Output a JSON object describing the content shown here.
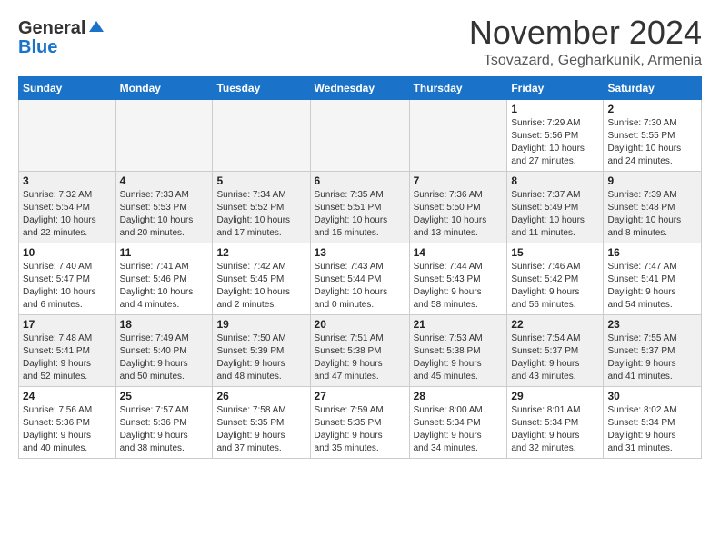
{
  "header": {
    "logo_general": "General",
    "logo_blue": "Blue",
    "month_title": "November 2024",
    "location": "Tsovazard, Gegharkunik, Armenia"
  },
  "calendar": {
    "weekdays": [
      "Sunday",
      "Monday",
      "Tuesday",
      "Wednesday",
      "Thursday",
      "Friday",
      "Saturday"
    ],
    "weeks": [
      [
        {
          "day": "",
          "info": ""
        },
        {
          "day": "",
          "info": ""
        },
        {
          "day": "",
          "info": ""
        },
        {
          "day": "",
          "info": ""
        },
        {
          "day": "",
          "info": ""
        },
        {
          "day": "1",
          "info": "Sunrise: 7:29 AM\nSunset: 5:56 PM\nDaylight: 10 hours\nand 27 minutes."
        },
        {
          "day": "2",
          "info": "Sunrise: 7:30 AM\nSunset: 5:55 PM\nDaylight: 10 hours\nand 24 minutes."
        }
      ],
      [
        {
          "day": "3",
          "info": "Sunrise: 7:32 AM\nSunset: 5:54 PM\nDaylight: 10 hours\nand 22 minutes."
        },
        {
          "day": "4",
          "info": "Sunrise: 7:33 AM\nSunset: 5:53 PM\nDaylight: 10 hours\nand 20 minutes."
        },
        {
          "day": "5",
          "info": "Sunrise: 7:34 AM\nSunset: 5:52 PM\nDaylight: 10 hours\nand 17 minutes."
        },
        {
          "day": "6",
          "info": "Sunrise: 7:35 AM\nSunset: 5:51 PM\nDaylight: 10 hours\nand 15 minutes."
        },
        {
          "day": "7",
          "info": "Sunrise: 7:36 AM\nSunset: 5:50 PM\nDaylight: 10 hours\nand 13 minutes."
        },
        {
          "day": "8",
          "info": "Sunrise: 7:37 AM\nSunset: 5:49 PM\nDaylight: 10 hours\nand 11 minutes."
        },
        {
          "day": "9",
          "info": "Sunrise: 7:39 AM\nSunset: 5:48 PM\nDaylight: 10 hours\nand 8 minutes."
        }
      ],
      [
        {
          "day": "10",
          "info": "Sunrise: 7:40 AM\nSunset: 5:47 PM\nDaylight: 10 hours\nand 6 minutes."
        },
        {
          "day": "11",
          "info": "Sunrise: 7:41 AM\nSunset: 5:46 PM\nDaylight: 10 hours\nand 4 minutes."
        },
        {
          "day": "12",
          "info": "Sunrise: 7:42 AM\nSunset: 5:45 PM\nDaylight: 10 hours\nand 2 minutes."
        },
        {
          "day": "13",
          "info": "Sunrise: 7:43 AM\nSunset: 5:44 PM\nDaylight: 10 hours\nand 0 minutes."
        },
        {
          "day": "14",
          "info": "Sunrise: 7:44 AM\nSunset: 5:43 PM\nDaylight: 9 hours\nand 58 minutes."
        },
        {
          "day": "15",
          "info": "Sunrise: 7:46 AM\nSunset: 5:42 PM\nDaylight: 9 hours\nand 56 minutes."
        },
        {
          "day": "16",
          "info": "Sunrise: 7:47 AM\nSunset: 5:41 PM\nDaylight: 9 hours\nand 54 minutes."
        }
      ],
      [
        {
          "day": "17",
          "info": "Sunrise: 7:48 AM\nSunset: 5:41 PM\nDaylight: 9 hours\nand 52 minutes."
        },
        {
          "day": "18",
          "info": "Sunrise: 7:49 AM\nSunset: 5:40 PM\nDaylight: 9 hours\nand 50 minutes."
        },
        {
          "day": "19",
          "info": "Sunrise: 7:50 AM\nSunset: 5:39 PM\nDaylight: 9 hours\nand 48 minutes."
        },
        {
          "day": "20",
          "info": "Sunrise: 7:51 AM\nSunset: 5:38 PM\nDaylight: 9 hours\nand 47 minutes."
        },
        {
          "day": "21",
          "info": "Sunrise: 7:53 AM\nSunset: 5:38 PM\nDaylight: 9 hours\nand 45 minutes."
        },
        {
          "day": "22",
          "info": "Sunrise: 7:54 AM\nSunset: 5:37 PM\nDaylight: 9 hours\nand 43 minutes."
        },
        {
          "day": "23",
          "info": "Sunrise: 7:55 AM\nSunset: 5:37 PM\nDaylight: 9 hours\nand 41 minutes."
        }
      ],
      [
        {
          "day": "24",
          "info": "Sunrise: 7:56 AM\nSunset: 5:36 PM\nDaylight: 9 hours\nand 40 minutes."
        },
        {
          "day": "25",
          "info": "Sunrise: 7:57 AM\nSunset: 5:36 PM\nDaylight: 9 hours\nand 38 minutes."
        },
        {
          "day": "26",
          "info": "Sunrise: 7:58 AM\nSunset: 5:35 PM\nDaylight: 9 hours\nand 37 minutes."
        },
        {
          "day": "27",
          "info": "Sunrise: 7:59 AM\nSunset: 5:35 PM\nDaylight: 9 hours\nand 35 minutes."
        },
        {
          "day": "28",
          "info": "Sunrise: 8:00 AM\nSunset: 5:34 PM\nDaylight: 9 hours\nand 34 minutes."
        },
        {
          "day": "29",
          "info": "Sunrise: 8:01 AM\nSunset: 5:34 PM\nDaylight: 9 hours\nand 32 minutes."
        },
        {
          "day": "30",
          "info": "Sunrise: 8:02 AM\nSunset: 5:34 PM\nDaylight: 9 hours\nand 31 minutes."
        }
      ]
    ]
  }
}
